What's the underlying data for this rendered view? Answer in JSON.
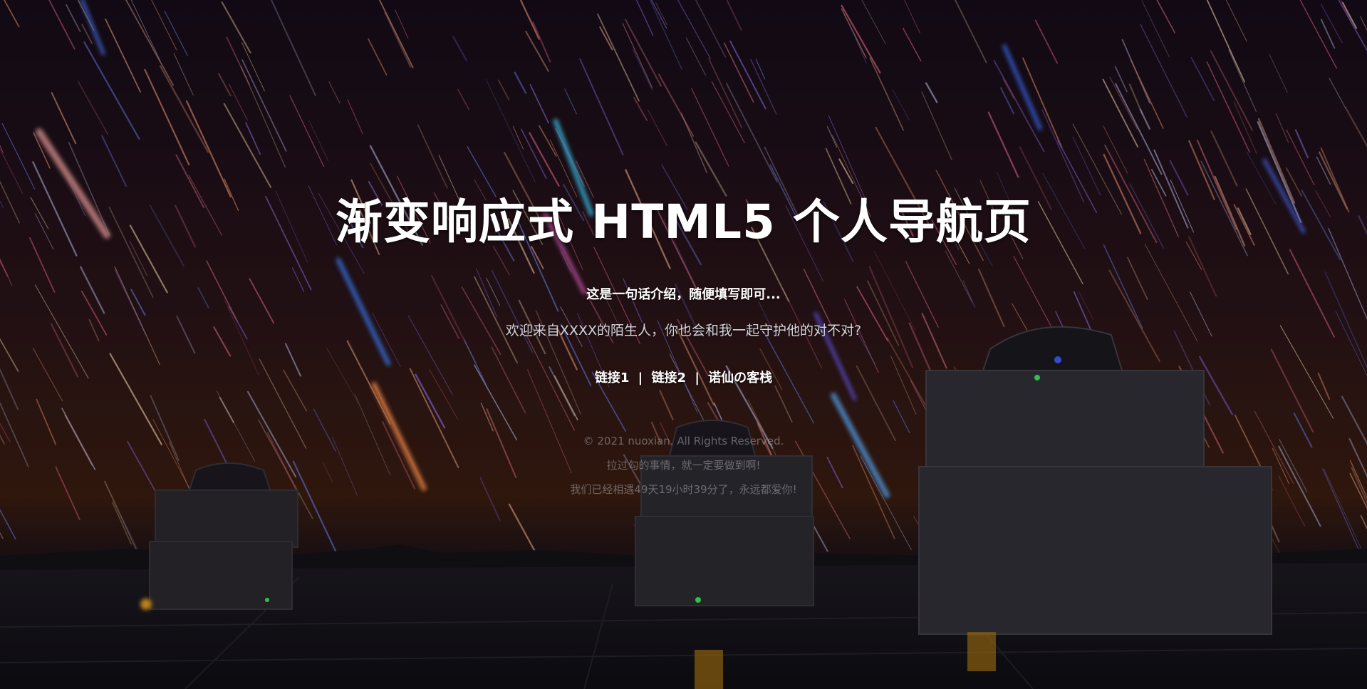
{
  "hero": {
    "title": "渐变响应式 HTML5 个人导航页",
    "tagline": "这是一句话介绍，随便填写即可...",
    "welcome": "欢迎来自XXXX的陌生人，你也会和我一起守护他的对不对?"
  },
  "links": {
    "items": [
      {
        "label": "链接1"
      },
      {
        "label": "链接2"
      },
      {
        "label": "诺仙の客栈"
      }
    ],
    "separator": "|"
  },
  "footer": {
    "copyright": "© 2021 nuoxian. All Rights Reserved.",
    "line2": "拉过勾的事情，就一定要做到啊!",
    "line3": "我们已经相遇49天19小时39分了，永远都爱你!"
  },
  "background": {
    "description_icon": "star-trails-observatory-image",
    "sky_top": "#1a0f1e",
    "sky_horizon": "#3a1a0e",
    "ground": "#15141a"
  }
}
